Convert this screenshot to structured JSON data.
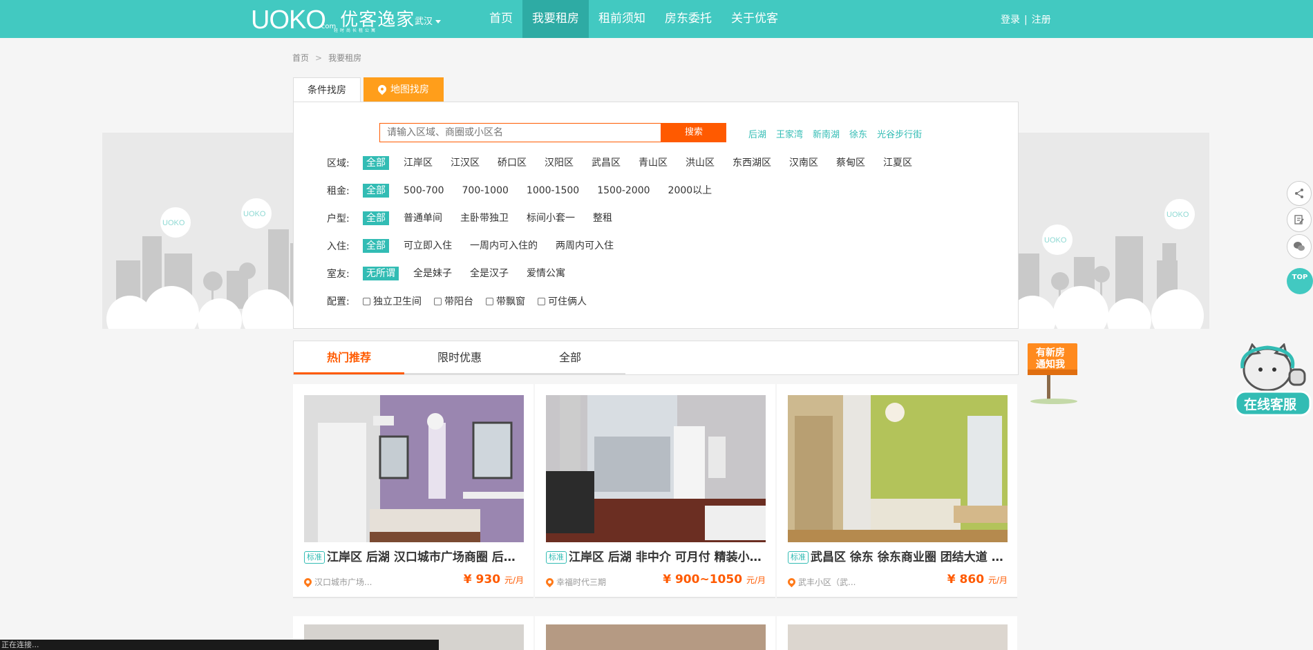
{
  "header": {
    "logo_main": "UOKO",
    "logo_com": "com",
    "logo_cn": "优客逸家",
    "logo_sub": "轻时尚长租公寓",
    "city": "武汉",
    "nav": [
      "首页",
      "我要租房",
      "租前须知",
      "房东委托",
      "关于优客"
    ],
    "login": "登录",
    "auth_sep": "|",
    "register": "注册"
  },
  "breadcrumb": {
    "home": "首页",
    "sep": ">",
    "current": "我要租房"
  },
  "search_tabs": {
    "condition": "条件找房",
    "map": "地图找房"
  },
  "search": {
    "placeholder": "请输入区域、商圈或小区名",
    "button": "搜索",
    "hot": [
      "后湖",
      "王家湾",
      "新南湖",
      "徐东",
      "光谷步行街"
    ]
  },
  "filters": {
    "district": {
      "label": "区域:",
      "options": [
        "全部",
        "江岸区",
        "江汉区",
        "硚口区",
        "汉阳区",
        "武昌区",
        "青山区",
        "洪山区",
        "东西湖区",
        "汉南区",
        "蔡甸区",
        "江夏区"
      ]
    },
    "rent": {
      "label": "租金:",
      "options": [
        "全部",
        "500-700",
        "700-1000",
        "1000-1500",
        "1500-2000",
        "2000以上"
      ]
    },
    "layout": {
      "label": "户型:",
      "options": [
        "全部",
        "普通单间",
        "主卧带独卫",
        "标间小套一",
        "整租"
      ]
    },
    "movein": {
      "label": "入住:",
      "options": [
        "全部",
        "可立即入住",
        "一周内可入住的",
        "两周内可入住"
      ]
    },
    "roommate": {
      "label": "室友:",
      "options": [
        "无所谓",
        "全是妹子",
        "全是汉子",
        "爱情公寓"
      ]
    },
    "config": {
      "label": "配置:",
      "options": [
        "独立卫生间",
        "带阳台",
        "带飘窗",
        "可住俩人"
      ]
    }
  },
  "list_tabs": [
    "热门推荐",
    "限时优惠",
    "全部"
  ],
  "cards": [
    {
      "tag": "标准",
      "title": "江岸区 后湖 汉口城市广场商圈 后湖...",
      "location": "汉口城市广场...",
      "price": "¥ 930",
      "unit": "元/月"
    },
    {
      "tag": "标准",
      "title": "江岸区 后湖 非中介 可月付 精装小户 ...",
      "location": "幸福时代三期",
      "price": "¥ 900~1050",
      "unit": "元/月"
    },
    {
      "tag": "标准",
      "title": "武昌区 徐东 徐东商业圈 团结大道 园...",
      "location": "武丰小区（武...",
      "price": "¥ 860",
      "unit": "元/月"
    }
  ],
  "side": {
    "brand_bubble": "UOKO",
    "top": "TOP",
    "notify_line1": "有新房",
    "notify_line2": "通知我",
    "customer_service": "在线客服"
  },
  "status_bar": "正在连接..."
}
